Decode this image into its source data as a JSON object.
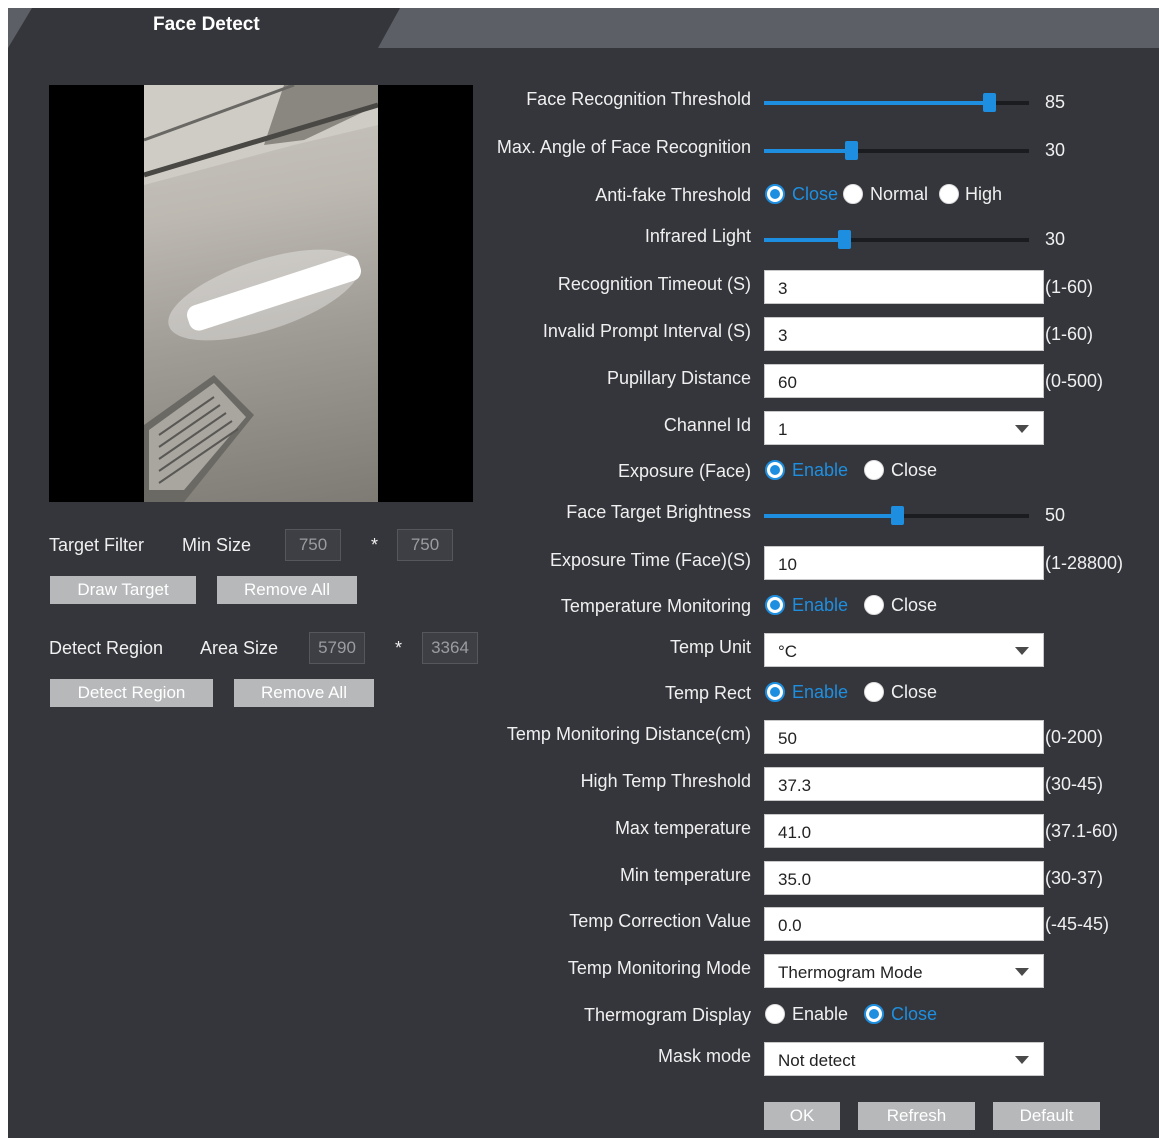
{
  "tab": {
    "title": "Face Detect"
  },
  "left": {
    "target_filter": {
      "label": "Target Filter",
      "min_size_label": "Min Size",
      "width": "750",
      "sep": "*",
      "height": "750",
      "draw_button": "Draw Target",
      "remove_button": "Remove All"
    },
    "detect_region": {
      "label": "Detect Region",
      "area_size_label": "Area Size",
      "width": "5790",
      "sep": "*",
      "height": "3364",
      "detect_button": "Detect Region",
      "remove_button": "Remove All"
    }
  },
  "settings": {
    "face_recognition_threshold": {
      "label": "Face Recognition Threshold",
      "value": "85",
      "fraction": 0.85
    },
    "max_angle": {
      "label": "Max. Angle of Face Recognition",
      "value": "30",
      "fraction": 0.33
    },
    "anti_fake": {
      "label": "Anti-fake Threshold",
      "options": [
        "Close",
        "Normal",
        "High"
      ],
      "selected": "Close"
    },
    "infrared_light": {
      "label": "Infrared Light",
      "value": "30",
      "fraction": 0.3
    },
    "recognition_timeout": {
      "label": "Recognition Timeout (S)",
      "value": "3",
      "range": "(1-60)"
    },
    "invalid_prompt_interval": {
      "label": "Invalid Prompt Interval (S)",
      "value": "3",
      "range": "(1-60)"
    },
    "pupillary_distance": {
      "label": "Pupillary Distance",
      "value": "60",
      "range": "(0-500)"
    },
    "channel_id": {
      "label": "Channel Id",
      "value": "1"
    },
    "exposure_face": {
      "label": "Exposure (Face)",
      "options": [
        "Enable",
        "Close"
      ],
      "selected": "Enable"
    },
    "face_target_brightness": {
      "label": "Face Target Brightness",
      "value": "50",
      "fraction": 0.5
    },
    "exposure_time": {
      "label": "Exposure Time (Face)(S)",
      "value": "10",
      "range": "(1-28800)"
    },
    "temperature_monitoring": {
      "label": "Temperature Monitoring",
      "options": [
        "Enable",
        "Close"
      ],
      "selected": "Enable"
    },
    "temp_unit": {
      "label": "Temp Unit",
      "value": "°C"
    },
    "temp_rect": {
      "label": "Temp Rect",
      "options": [
        "Enable",
        "Close"
      ],
      "selected": "Enable"
    },
    "temp_monitoring_distance": {
      "label": "Temp Monitoring Distance(cm)",
      "value": "50",
      "range": "(0-200)"
    },
    "high_temp_threshold": {
      "label": "High Temp Threshold",
      "value": "37.3",
      "range": "(30-45)"
    },
    "max_temperature": {
      "label": "Max temperature",
      "value": "41.0",
      "range": "(37.1-60)"
    },
    "min_temperature": {
      "label": "Min temperature",
      "value": "35.0",
      "range": "(30-37)"
    },
    "temp_correction": {
      "label": "Temp Correction Value",
      "value": "0.0",
      "range": "(-45-45)"
    },
    "temp_monitoring_mode": {
      "label": "Temp Monitoring Mode",
      "value": "Thermogram Mode"
    },
    "thermogram_display": {
      "label": "Thermogram Display",
      "options": [
        "Enable",
        "Close"
      ],
      "selected": "Close"
    },
    "mask_mode": {
      "label": "Mask mode",
      "value": "Not detect"
    }
  },
  "buttons": {
    "ok": "OK",
    "refresh": "Refresh",
    "default": "Default"
  },
  "colors": {
    "accent": "#1e8fe0",
    "panel": "#35363b",
    "frame": "#4a4c53"
  }
}
